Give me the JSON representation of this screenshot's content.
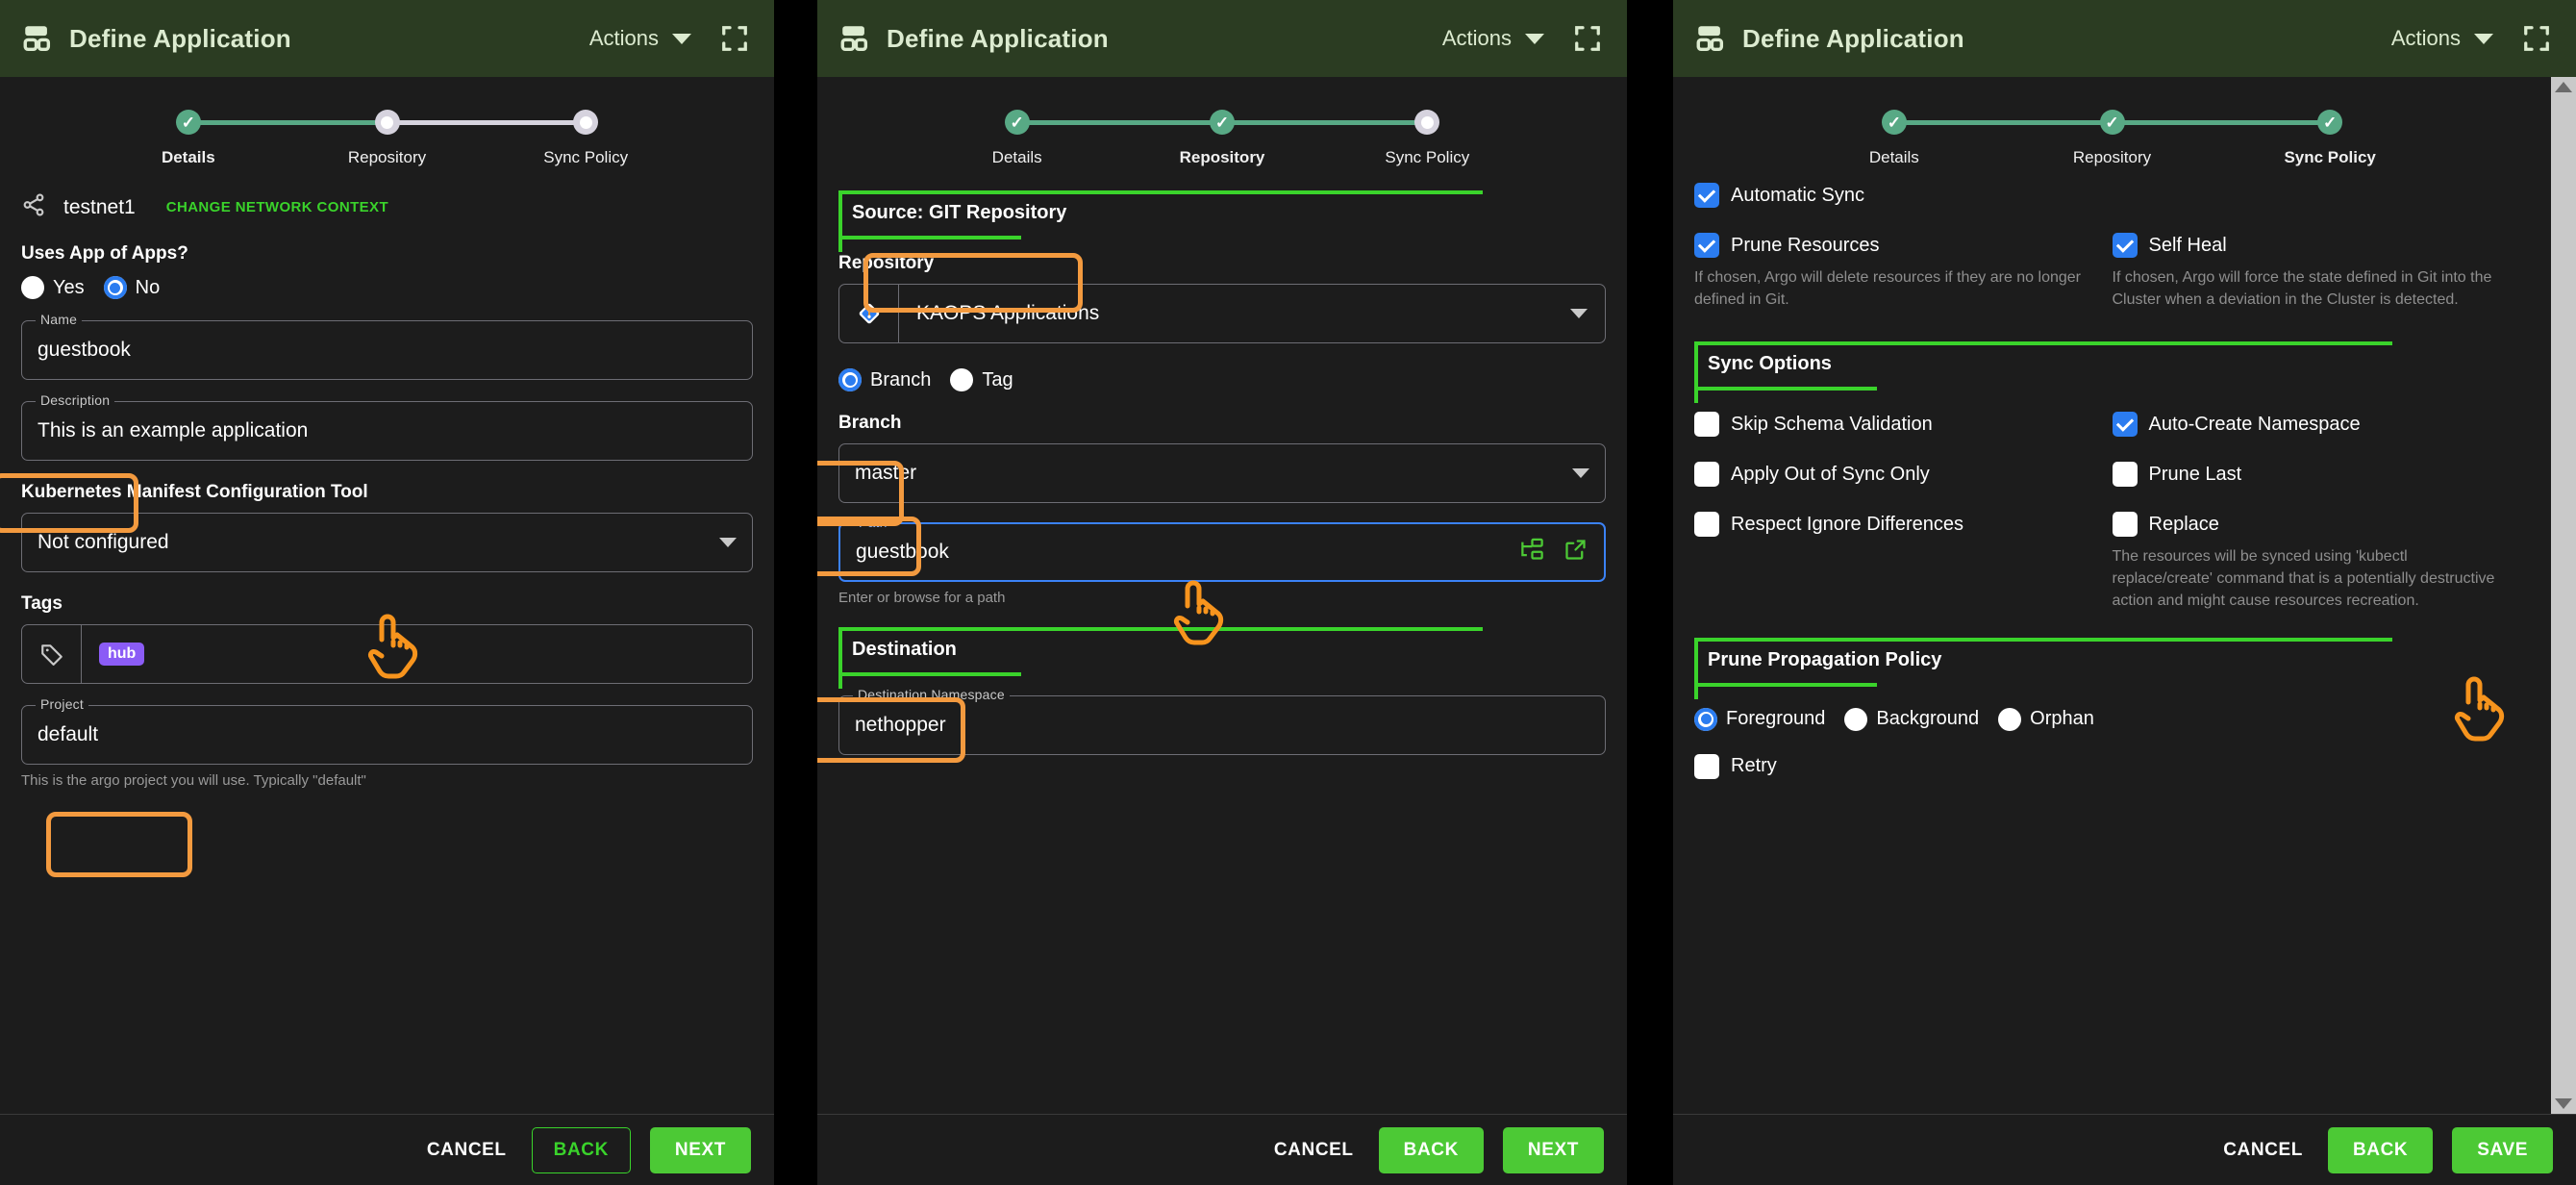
{
  "window": {
    "title": "Define Application",
    "actions_label": "Actions",
    "icons": {
      "app": "application-icon",
      "caret": "chevron-down-icon",
      "fullscreen": "fullscreen-icon"
    }
  },
  "colors": {
    "titlebar_bg": "#2b3c22",
    "panel_bg": "#1c1c1c",
    "accent_green": "#4cc935",
    "annotation_orange": "#f39a3f",
    "annotation_green": "#3ad32b",
    "step_done": "#58a985",
    "radio_blue": "#2b7cf0",
    "chip_purple": "#8b5cf6"
  },
  "stepper": {
    "steps": [
      {
        "label": "Details",
        "state": "done"
      },
      {
        "label": "Repository",
        "state": "pending"
      },
      {
        "label": "Sync Policy",
        "state": "pending"
      }
    ]
  },
  "panel1": {
    "stepper": [
      {
        "label": "Details",
        "state": "done",
        "active": true
      },
      {
        "label": "Repository",
        "state": "pending",
        "active": false
      },
      {
        "label": "Sync Policy",
        "state": "pending",
        "active": false
      }
    ],
    "network_context": {
      "icon": "share-nodes-icon",
      "name": "testnet1",
      "change_link": "CHANGE NETWORK CONTEXT"
    },
    "app_of_apps": {
      "question": "Uses App of Apps?",
      "options": [
        {
          "label": "Yes",
          "selected": false
        },
        {
          "label": "No",
          "selected": true
        }
      ]
    },
    "name_field": {
      "legend": "Name",
      "value": "guestbook"
    },
    "description_field": {
      "legend": "Description",
      "value": "This is an example application"
    },
    "manifest_tool": {
      "label": "Kubernetes Manifest Configuration Tool",
      "value": "Not configured"
    },
    "tags": {
      "label": "Tags",
      "icon": "tag-icon",
      "chips": [
        "hub"
      ]
    },
    "project_field": {
      "legend": "Project",
      "value": "default",
      "helper": "This is the argo project you will use. Typically \"default\""
    },
    "footer": {
      "cancel": "CANCEL",
      "back": "BACK",
      "next": "NEXT"
    }
  },
  "panel2": {
    "stepper": [
      {
        "label": "Details",
        "state": "done",
        "active": false
      },
      {
        "label": "Repository",
        "state": "done",
        "active": true
      },
      {
        "label": "Sync Policy",
        "state": "pending",
        "active": false
      }
    ],
    "source_section": "Source: GIT Repository",
    "repository": {
      "label": "Repository",
      "icon": "git-diamond-icon",
      "value": "KAOPS Applications"
    },
    "ref_type": {
      "options": [
        {
          "label": "Branch",
          "selected": true
        },
        {
          "label": "Tag",
          "selected": false
        }
      ]
    },
    "branch": {
      "label": "Branch",
      "value": "master"
    },
    "path": {
      "legend": "Path",
      "value": "guestbook",
      "helper": "Enter or browse for a path",
      "icons": [
        "browse-tree-icon",
        "open-external-icon"
      ]
    },
    "destination_section": "Destination",
    "destination_namespace": {
      "legend": "Destination Namespace",
      "value": "nethopper"
    },
    "footer": {
      "cancel": "CANCEL",
      "back": "BACK",
      "next": "NEXT"
    }
  },
  "panel3": {
    "stepper": [
      {
        "label": "Details",
        "state": "done",
        "active": false
      },
      {
        "label": "Repository",
        "state": "done",
        "active": false
      },
      {
        "label": "Sync Policy",
        "state": "done",
        "active": true
      }
    ],
    "automatic_sync": {
      "label": "Automatic Sync",
      "checked": true
    },
    "prune_resources": {
      "label": "Prune Resources",
      "checked": true,
      "description": "If chosen, Argo will delete resources if they are no longer defined in Git."
    },
    "self_heal": {
      "label": "Self Heal",
      "checked": true,
      "description": "If chosen, Argo will force the state defined in Git into the Cluster when a deviation in the Cluster is detected."
    },
    "sync_options_section": "Sync Options",
    "sync_options": [
      {
        "label": "Skip Schema Validation",
        "checked": false
      },
      {
        "label": "Auto-Create Namespace",
        "checked": true
      },
      {
        "label": "Apply Out of Sync Only",
        "checked": false
      },
      {
        "label": "Prune Last",
        "checked": false
      },
      {
        "label": "Respect Ignore Differences",
        "checked": false
      },
      {
        "label": "Replace",
        "checked": false
      }
    ],
    "replace_description": "The resources will be synced using 'kubectl replace/create' command that is a potentially destructive action and might cause resources recreation.",
    "prune_propagation_section": "Prune Propagation Policy",
    "prune_propagation": [
      {
        "label": "Foreground",
        "selected": true
      },
      {
        "label": "Background",
        "selected": false
      },
      {
        "label": "Orphan",
        "selected": false
      }
    ],
    "retry": {
      "label": "Retry",
      "checked": false
    },
    "footer": {
      "cancel": "CANCEL",
      "back": "BACK",
      "save": "SAVE"
    }
  }
}
